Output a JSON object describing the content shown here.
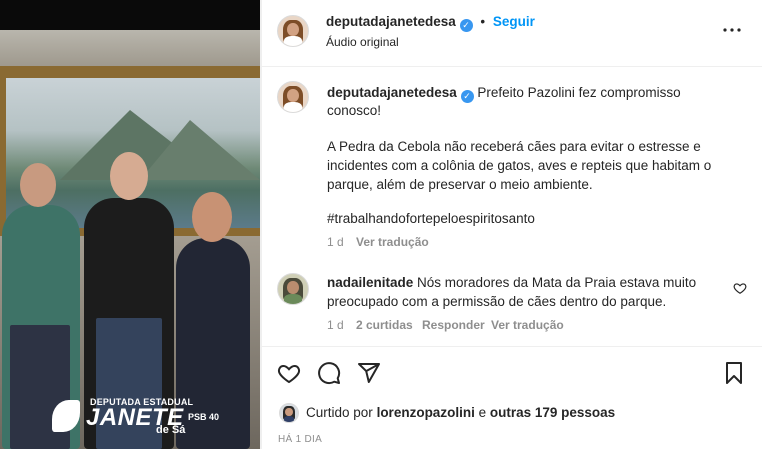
{
  "post": {
    "username": "deputadajanetedesa",
    "dot": "•",
    "follow_label": "Seguir",
    "audio_label": "Áudio original",
    "more_label": "•••"
  },
  "media": {
    "logo_top": "DEPUTADA ESTADUAL",
    "logo_name": "JANETE",
    "logo_sub": "de Sá",
    "logo_party": "PSB 40"
  },
  "caption": {
    "username": "deputadajanetedesa",
    "line1": "Prefeito Pazolini fez compromisso",
    "line2": "conosco!",
    "line3": "A Pedra da Cebola não receberá cães para evitar o estresse e",
    "line4": "incidentes com a colônia de gatos, aves e repteis que habitam o",
    "line5": "parque, além de preservar o meio ambiente.",
    "hashtag": "#trabalhandofortepeloespiritosanto",
    "time": "1 d",
    "translate": "Ver tradução"
  },
  "comment": {
    "username": "nadailenitade",
    "line1": "Nós moradores da Mata da Praia estava muito",
    "line2": "preocupado com a permissão de cães dentro do parque.",
    "time": "1 d",
    "likes": "2 curtidas",
    "reply": "Responder",
    "translate": "Ver tradução"
  },
  "likes": {
    "prefix": "Curtido por",
    "user": "lorenzopazolini",
    "middle": "e",
    "others": "outras 179 pessoas"
  },
  "timestamp": "HÁ 1 DIA",
  "icons": {
    "like": "heart-icon",
    "comment": "comment-icon",
    "share": "paper-plane-icon",
    "save": "bookmark-icon",
    "more": "more-options-icon",
    "verified": "verified-badge-icon",
    "comment_like": "heart-small-icon"
  },
  "colors": {
    "accent": "#0095f6",
    "verified": "#3897f0",
    "text": "#262626",
    "muted": "#8e8e8e"
  }
}
